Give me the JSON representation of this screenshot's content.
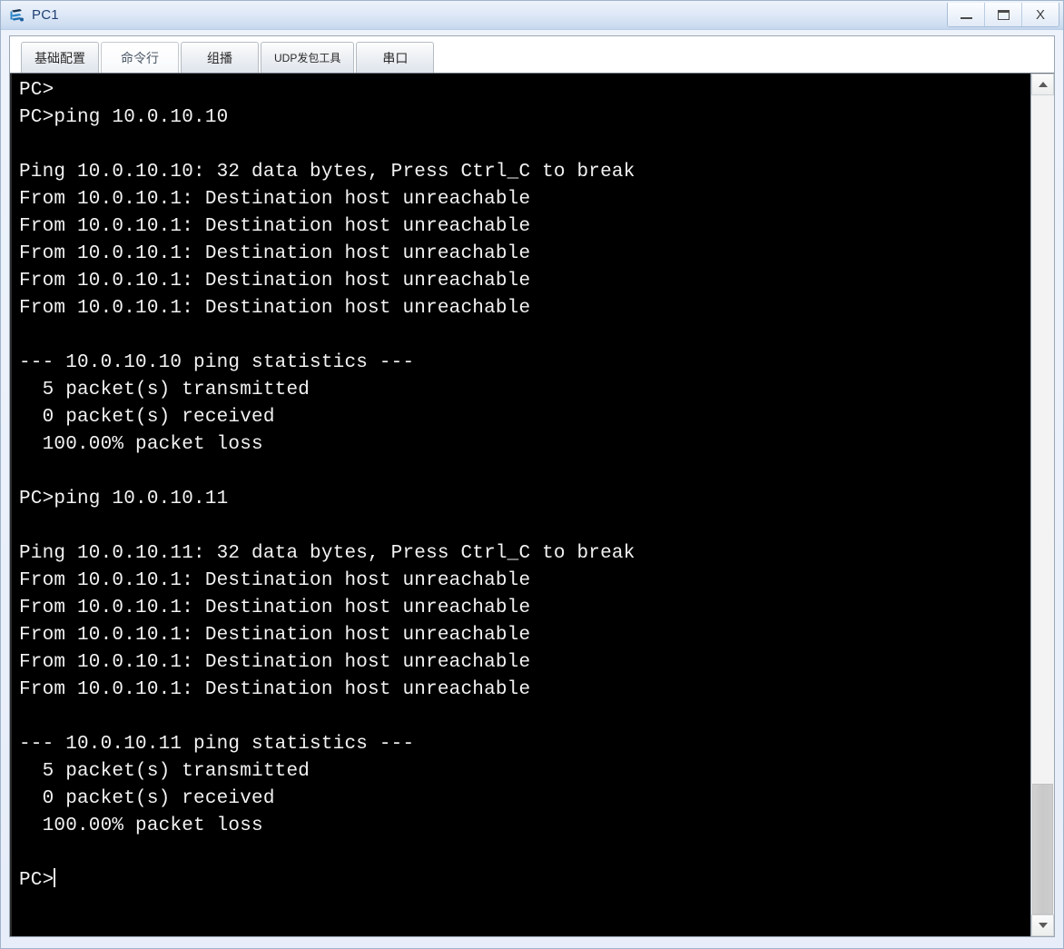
{
  "window": {
    "title": "PC1",
    "icon": "pc-device-icon",
    "controls": [
      {
        "name": "minimize",
        "label": "_"
      },
      {
        "name": "maximize",
        "label": "□"
      },
      {
        "name": "close",
        "label": "X"
      }
    ]
  },
  "tabs": [
    {
      "id": "basic-config",
      "label": "基础配置",
      "active": false
    },
    {
      "id": "command-line",
      "label": "命令行",
      "active": true
    },
    {
      "id": "multicast",
      "label": "组播",
      "active": false
    },
    {
      "id": "udp-packet-tool",
      "label": "UDP发包工具",
      "active": false
    },
    {
      "id": "serial-port",
      "label": "串口",
      "active": false
    }
  ],
  "terminal": {
    "prompt": "PC>",
    "cursor_visible": true,
    "lines": [
      "PC>",
      "PC>ping 10.0.10.10",
      "",
      "Ping 10.0.10.10: 32 data bytes, Press Ctrl_C to break",
      "From 10.0.10.1: Destination host unreachable",
      "From 10.0.10.1: Destination host unreachable",
      "From 10.0.10.1: Destination host unreachable",
      "From 10.0.10.1: Destination host unreachable",
      "From 10.0.10.1: Destination host unreachable",
      "",
      "--- 10.0.10.10 ping statistics ---",
      "  5 packet(s) transmitted",
      "  0 packet(s) received",
      "  100.00% packet loss",
      "",
      "PC>ping 10.0.10.11",
      "",
      "Ping 10.0.10.11: 32 data bytes, Press Ctrl_C to break",
      "From 10.0.10.1: Destination host unreachable",
      "From 10.0.10.1: Destination host unreachable",
      "From 10.0.10.1: Destination host unreachable",
      "From 10.0.10.1: Destination host unreachable",
      "From 10.0.10.1: Destination host unreachable",
      "",
      "--- 10.0.10.11 ping statistics ---",
      "  5 packet(s) transmitted",
      "  0 packet(s) received",
      "  100.00% packet loss",
      "",
      "PC>"
    ]
  },
  "scrollbar": {
    "up_arrow": "▲",
    "down_arrow": "▼",
    "thumb_top_pct": 84,
    "thumb_height_pct": 16
  },
  "colors": {
    "terminal_bg": "#000000",
    "terminal_fg": "#f2f2f2",
    "title_text": "#1f3f73",
    "accent": "#2a6ab0"
  }
}
